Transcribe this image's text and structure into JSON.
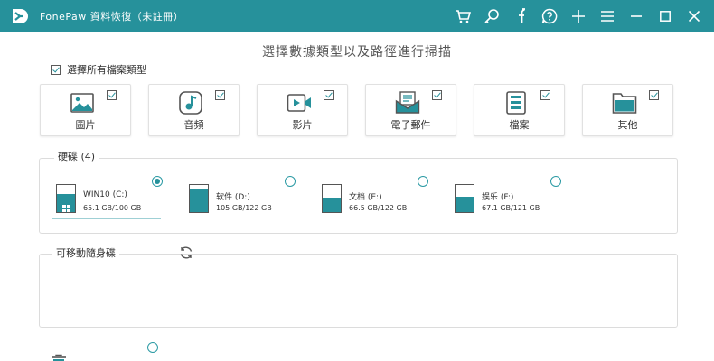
{
  "app": {
    "title": "FonePaw 資料恢復（未註冊）",
    "accent_color": "#26919b",
    "logo_icon": "fonepaw-logo-icon"
  },
  "titlebar_icons": [
    "cart-icon",
    "key-icon",
    "facebook-icon",
    "help-icon",
    "plus-icon",
    "menu-icon",
    "minimize-icon",
    "maximize-icon",
    "close-icon"
  ],
  "main": {
    "heading": "選擇數據類型以及路徑進行掃描"
  },
  "select_all": {
    "label": "選擇所有檔案類型",
    "checked": true
  },
  "file_types": [
    {
      "label": "圖片",
      "icon": "image-icon",
      "checked": true
    },
    {
      "label": "音頻",
      "icon": "music-icon",
      "checked": true
    },
    {
      "label": "影片",
      "icon": "video-icon",
      "checked": true
    },
    {
      "label": "電子郵件",
      "icon": "email-icon",
      "checked": true
    },
    {
      "label": "檔案",
      "icon": "document-icon",
      "checked": true
    },
    {
      "label": "其他",
      "icon": "folder-icon",
      "checked": true
    }
  ],
  "hard_drives": {
    "title": "硬碟 (4)",
    "drives": [
      {
        "name": "WIN10 (C:)",
        "size": "65.1 GB/100 GB",
        "used_fraction": 0.651,
        "selected": true,
        "system": true
      },
      {
        "name": "软件 (D:)",
        "size": "105 GB/122 GB",
        "used_fraction": 0.86,
        "selected": false,
        "system": false
      },
      {
        "name": "文档 (E:)",
        "size": "66.5 GB/122 GB",
        "used_fraction": 0.545,
        "selected": false,
        "system": false
      },
      {
        "name": "娱乐 (F:)",
        "size": "67.1 GB/121 GB",
        "used_fraction": 0.555,
        "selected": false,
        "system": false
      }
    ]
  },
  "removable": {
    "title": "可移動隨身碟",
    "refresh_icon": "refresh-icon"
  },
  "recycle_bin": {
    "icon": "trash-icon",
    "selected": false
  }
}
